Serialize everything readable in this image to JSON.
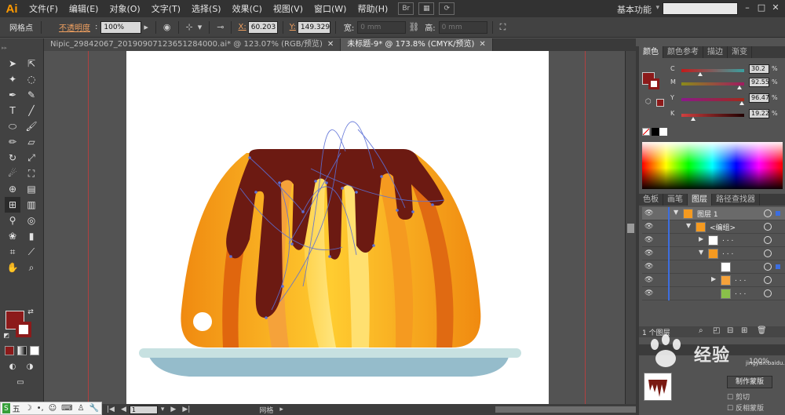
{
  "menubar": {
    "logo": "Ai",
    "items": [
      "文件(F)",
      "编辑(E)",
      "对象(O)",
      "文字(T)",
      "选择(S)",
      "效果(C)",
      "视图(V)",
      "窗口(W)",
      "帮助(H)"
    ],
    "workspace": "基本功能",
    "search_placeholder": ""
  },
  "controlbar": {
    "selection_label": "网格点",
    "opacity_label": "不透明度",
    "opacity_value": "100%",
    "x_label": "X:",
    "x_value": "60.203",
    "y_label": "Y:",
    "y_value": "149.329",
    "w_label": "宽:",
    "w_value": "0 mm",
    "h_label": "高:",
    "h_value": "0 mm"
  },
  "tabs": [
    {
      "label": "Nipic_29842067_20190907123651284000.ai* @ 123.07% (RGB/预览)",
      "active": false
    },
    {
      "label": "未标题-9* @ 173.8% (CMYK/预览)",
      "active": true
    }
  ],
  "status": {
    "zoom": "173.8%",
    "page": "1",
    "tool_name": "网格"
  },
  "color_panel": {
    "tabs": [
      "颜色",
      "颜色参考",
      "描边",
      "渐变"
    ],
    "channels": [
      {
        "name": "C",
        "value": "30.2",
        "fraction": 0.302,
        "track": "linear-gradient(to right,#c41a1a,#3aa0a0)"
      },
      {
        "name": "M",
        "value": "92.55",
        "fraction": 0.9255,
        "track": "linear-gradient(to right,#8a8a1a,#a01a60)"
      },
      {
        "name": "Y",
        "value": "96.47",
        "fraction": 0.9647,
        "track": "linear-gradient(to right,#8a1a8a,#a02a1a)"
      },
      {
        "name": "K",
        "value": "19.22",
        "fraction": 0.1922,
        "track": "linear-gradient(to right,#d04040,#200000)"
      }
    ],
    "pct": "%",
    "fill_color": "#8c1a1a"
  },
  "layers_panel": {
    "tabs": [
      "色板",
      "画笔",
      "图层",
      "路径查找器"
    ],
    "rows": [
      {
        "name": "图层 1",
        "indent": 0,
        "tri": "▼"
      },
      {
        "name": "<编组>",
        "indent": 1,
        "tri": "▼"
      },
      {
        "name": ". . .",
        "indent": 2,
        "tri": "▶"
      },
      {
        "name": ". . .",
        "indent": 2,
        "tri": "▼"
      },
      {
        "name": "",
        "indent": 3,
        "tri": ""
      },
      {
        "name": ". . .",
        "indent": 3,
        "tri": "▶"
      },
      {
        "name": ". . .",
        "indent": 3,
        "tri": ""
      }
    ],
    "count": "1 个图层"
  },
  "transparency_panel": {
    "opacity": "100%",
    "mask_button": "制作蒙版",
    "clip_label": "剪切",
    "invert_label": "反相蒙版"
  },
  "ime_bar": {
    "logo": "S",
    "mode": "五"
  },
  "watermark": {
    "text": "经验",
    "url": "jingyan.baidu.com"
  }
}
